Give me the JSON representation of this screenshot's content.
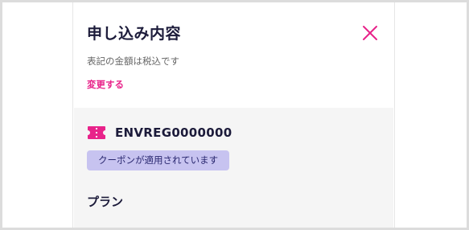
{
  "modal": {
    "title": "申し込み内容",
    "subtitle": "表記の金額は税込です",
    "change_label": "変更する",
    "close_icon": "close-icon"
  },
  "coupon": {
    "icon": "ticket-icon",
    "code": "ENVREG0000000",
    "status": "クーポンが適用されています"
  },
  "plan": {
    "heading": "プラン"
  },
  "colors": {
    "accent": "#e8238a",
    "badge_bg": "#c7c3f0",
    "body_bg": "#f5f5f5",
    "heading_text": "#1c1b3a"
  }
}
